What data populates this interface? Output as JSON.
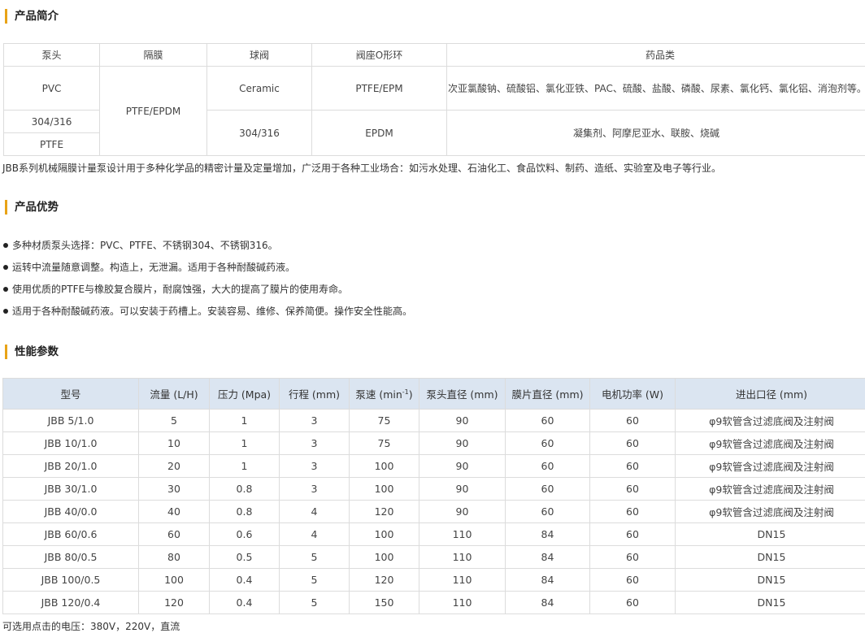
{
  "sections": {
    "intro_title": "产品简介",
    "advantages_title": "产品优势",
    "params_title": "性能参数"
  },
  "intro_table": {
    "headers": [
      "泵头",
      "隔膜",
      "球阀",
      "阀座O形环",
      "药品类"
    ],
    "pump_heads": [
      "PVC",
      "304/316",
      "PTFE"
    ],
    "diaphragm": "PTFE/EPDM",
    "ball_valves": [
      "Ceramic",
      "304/316"
    ],
    "seat_rings": [
      "PTFE/EPM",
      "EPDM"
    ],
    "chemicals": [
      "次亚氯酸钠、硫酸铝、氯化亚铁、PAC、硫酸、盐酸、磷酸、尿素、氯化钙、氯化铝、消泡剂等。",
      "凝集剂、阿摩尼亚水、联胺、烧碱"
    ]
  },
  "intro_paragraph": "JBB系列机械隔膜计量泵设计用于多种化学品的精密计量及定量增加，广泛用于各种工业场合：如污水处理、石油化工、食品饮料、制药、造纸、实验室及电子等行业。",
  "advantages": [
    "多种材质泵头选择：PVC、PTFE、不锈钢304、不锈钢316。",
    "运转中流量随意调整。构造上，无泄漏。适用于各种耐酸碱药液。",
    "使用优质的PTFE与橡胶复合膜片，耐腐蚀强，大大的提高了膜片的使用寿命。",
    "适用于各种耐酸碱药液。可以安装于药槽上。安装容易、维修、保养简便。操作安全性能高。"
  ],
  "params_table": {
    "headers": [
      "型号",
      "流量 (L/H)",
      "压力 (Mpa)",
      "行程 (mm)",
      "泵速 (min",
      "泵头直径 (mm)",
      "膜片直径 (mm)",
      "电机功率 (W)",
      "进出口径 (mm)"
    ],
    "speed_superscript": "-1",
    "speed_close": ")",
    "rows": [
      [
        "JBB 5/1.0",
        "5",
        "1",
        "3",
        "75",
        "90",
        "60",
        "60",
        "φ9软管含过滤底阀及注射阀"
      ],
      [
        "JBB 10/1.0",
        "10",
        "1",
        "3",
        "75",
        "90",
        "60",
        "60",
        "φ9软管含过滤底阀及注射阀"
      ],
      [
        "JBB 20/1.0",
        "20",
        "1",
        "3",
        "100",
        "90",
        "60",
        "60",
        "φ9软管含过滤底阀及注射阀"
      ],
      [
        "JBB 30/1.0",
        "30",
        "0.8",
        "3",
        "100",
        "90",
        "60",
        "60",
        "φ9软管含过滤底阀及注射阀"
      ],
      [
        "JBB 40/0.0",
        "40",
        "0.8",
        "4",
        "120",
        "90",
        "60",
        "60",
        "φ9软管含过滤底阀及注射阀"
      ],
      [
        "JBB 60/0.6",
        "60",
        "0.6",
        "4",
        "100",
        "110",
        "84",
        "60",
        "DN15"
      ],
      [
        "JBB 80/0.5",
        "80",
        "0.5",
        "5",
        "100",
        "110",
        "84",
        "60",
        "DN15"
      ],
      [
        "JBB 100/0.5",
        "100",
        "0.4",
        "5",
        "120",
        "110",
        "84",
        "60",
        "DN15"
      ],
      [
        "JBB 120/0.4",
        "120",
        "0.4",
        "5",
        "150",
        "110",
        "84",
        "60",
        "DN15"
      ]
    ]
  },
  "footer_note": "可选用点击的电压：380V，220V，直流",
  "colors": {
    "accent": "#e8a317",
    "table_header_bg": "#dbe5f1"
  }
}
